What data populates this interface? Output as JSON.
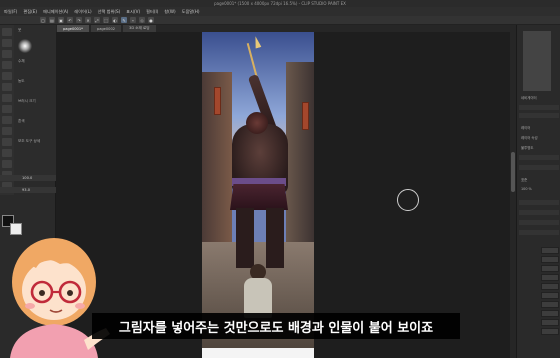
{
  "window": {
    "title": "page0001* (1500 x 4000px 72dpi 16.5%) - CLIP STUDIO PAINT EX"
  },
  "menubar": {
    "items": [
      "파일(F)",
      "편집(E)",
      "애니메이션(A)",
      "레이어(L)",
      "선택 범위(S)",
      "표시(V)",
      "필터(I)",
      "창(W)",
      "도움말(H)"
    ]
  },
  "toolbar": {
    "buttons": [
      "new-icon",
      "open-icon",
      "save-icon",
      "undo-icon",
      "redo-icon",
      "erase-icon",
      "transform-icon",
      "select-icon",
      "fill-icon",
      "pen-icon",
      "brush-icon",
      "eraser-icon",
      "color-icon"
    ]
  },
  "tabs": [
    {
      "label": "page0001*",
      "active": true
    },
    {
      "label": "page0002",
      "active": false
    },
    {
      "label": "3D 소재 로딩",
      "active": false
    }
  ],
  "left_panel": {
    "subtool_title": "붓",
    "rows": [
      "수채",
      "농도",
      "브러시 크기",
      "혼색",
      "보조 도구 상세"
    ],
    "size_value": "100.0",
    "opacity_value": "93.0"
  },
  "right_panel": {
    "labels": [
      "네비게이터",
      "레이어",
      "레이어 속성",
      "불투명도",
      "표준",
      "100 %"
    ]
  },
  "subtitle": "그림자를 넣어주는 것만으로도 배경과 인물이 붙어 보이죠",
  "colors": {
    "app_bg": "#1c1c1c",
    "panel_bg": "#2a2a2a",
    "subtitle_bg": "#000000",
    "subtitle_text": "#ffffff",
    "avatar_hair": "#f0a864",
    "avatar_shirt": "#f2a0b0"
  }
}
